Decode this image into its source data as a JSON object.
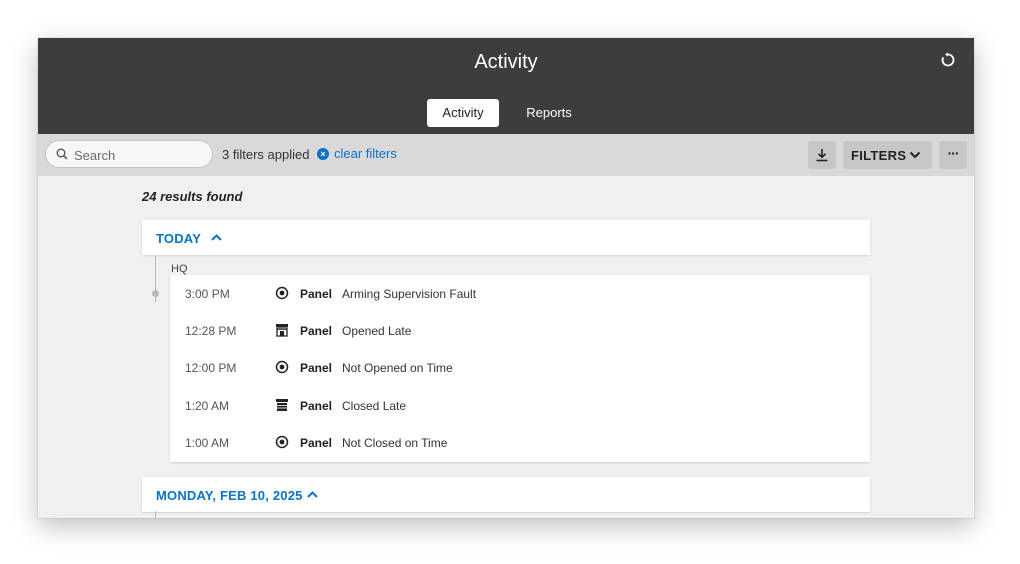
{
  "window": {
    "title": "Activity"
  },
  "tabs": [
    {
      "label": "Activity",
      "active": true
    },
    {
      "label": "Reports",
      "active": false
    }
  ],
  "toolbar": {
    "search_placeholder": "Search",
    "filters_applied": "3 filters applied",
    "clear_filters": "clear filters",
    "filters_label": "FILTERS"
  },
  "results": "24 results found",
  "groups": [
    {
      "label": "TODAY",
      "site": "HQ",
      "events": [
        {
          "time": "3:00 PM",
          "icon": "target-icon",
          "source": "Panel",
          "description": "Arming Supervision Fault"
        },
        {
          "time": "12:28 PM",
          "icon": "store-open-icon",
          "source": "Panel",
          "description": "Opened Late"
        },
        {
          "time": "12:00 PM",
          "icon": "target-icon",
          "source": "Panel",
          "description": "Not Opened on Time"
        },
        {
          "time": "1:20 AM",
          "icon": "store-closed-icon",
          "source": "Panel",
          "description": "Closed Late"
        },
        {
          "time": "1:00 AM",
          "icon": "target-icon",
          "source": "Panel",
          "description": "Not Closed on Time"
        }
      ]
    },
    {
      "label": "MONDAY, FEB 10, 2025"
    }
  ],
  "colors": {
    "header_bg": "#3d3d3d",
    "toolbar_bg": "#d9d9d9",
    "accent": "#0b72c7",
    "page_bg": "#f0f0f0"
  }
}
